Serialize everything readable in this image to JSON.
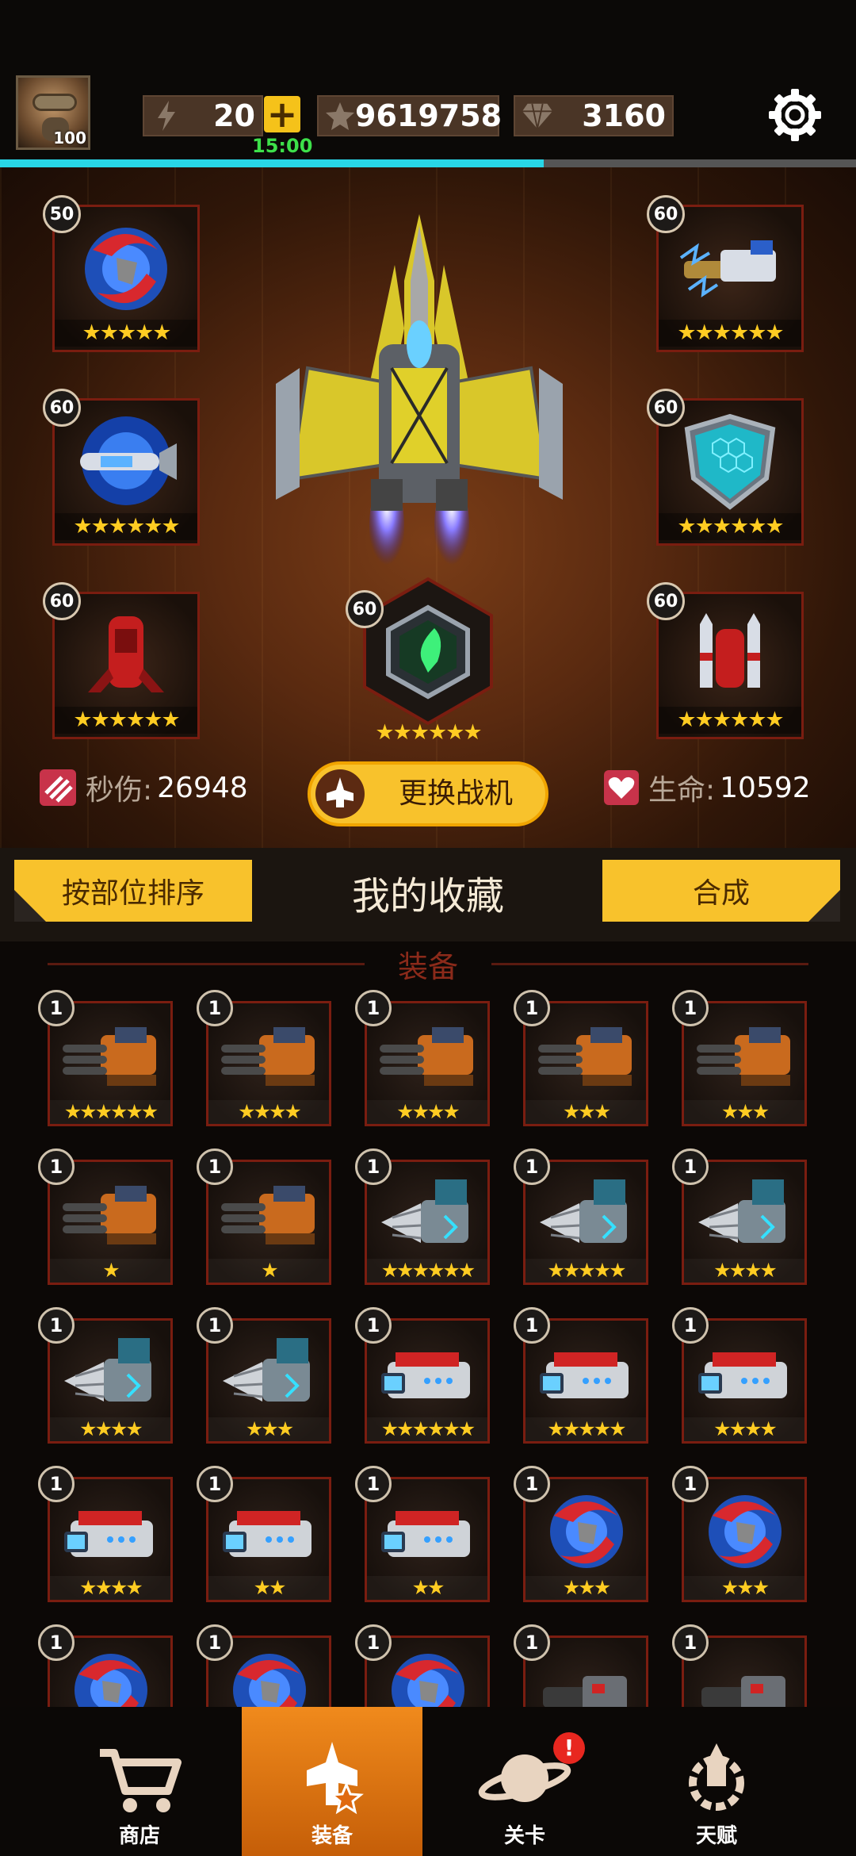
{
  "header": {
    "avatar_level": "100",
    "energy": "20",
    "energy_timer": "15:00",
    "stars": "9619758",
    "gems": "3160",
    "energy_progress": 0.635
  },
  "loadout": {
    "slots": [
      {
        "level": "50",
        "stars": "★★★★★",
        "icon": "red-blade-orb-icon"
      },
      {
        "level": "60",
        "stars": "★★★★★★",
        "icon": "electro-cannon-icon"
      },
      {
        "level": "60",
        "stars": "★★★★★★",
        "icon": "plasma-missile-icon"
      },
      {
        "level": "60",
        "stars": "★★★★★★",
        "icon": "hex-shield-icon"
      },
      {
        "level": "60",
        "stars": "★★★★★★",
        "icon": "red-drone-icon"
      },
      {
        "level": "60",
        "stars": "★★★★★★",
        "icon": "rocket-drone-icon"
      },
      {
        "level": "60",
        "stars": "★★★★★★",
        "icon": "green-core-icon"
      }
    ],
    "dps_label": "秒伤:",
    "dps_value": "26948",
    "hp_label": "生命:",
    "hp_value": "10592",
    "change_button": "更换战机"
  },
  "collection": {
    "sort_button": "按部位排序",
    "title": "我的收藏",
    "merge_button": "合成",
    "section_title": "装备"
  },
  "equipment": [
    {
      "level": "1",
      "stars": "★★★★★★",
      "type": "gatling"
    },
    {
      "level": "1",
      "stars": "★★★★",
      "type": "gatling"
    },
    {
      "level": "1",
      "stars": "★★★★",
      "type": "gatling"
    },
    {
      "level": "1",
      "stars": "★★★",
      "type": "gatling"
    },
    {
      "level": "1",
      "stars": "★★★",
      "type": "gatling"
    },
    {
      "level": "1",
      "stars": "★",
      "type": "gatling"
    },
    {
      "level": "1",
      "stars": "★",
      "type": "gatling"
    },
    {
      "level": "1",
      "stars": "★★★★★★",
      "type": "drill"
    },
    {
      "level": "1",
      "stars": "★★★★★",
      "type": "drill"
    },
    {
      "level": "1",
      "stars": "★★★★",
      "type": "drill"
    },
    {
      "level": "1",
      "stars": "★★★★",
      "type": "drill"
    },
    {
      "level": "1",
      "stars": "★★★",
      "type": "drill"
    },
    {
      "level": "1",
      "stars": "★★★★★★",
      "type": "laser"
    },
    {
      "level": "1",
      "stars": "★★★★★",
      "type": "laser"
    },
    {
      "level": "1",
      "stars": "★★★★",
      "type": "laser"
    },
    {
      "level": "1",
      "stars": "★★★★",
      "type": "laser"
    },
    {
      "level": "1",
      "stars": "★★",
      "type": "laser"
    },
    {
      "level": "1",
      "stars": "★★",
      "type": "laser"
    },
    {
      "level": "1",
      "stars": "★★★",
      "type": "orb"
    },
    {
      "level": "1",
      "stars": "★★★",
      "type": "orb"
    },
    {
      "level": "1",
      "stars": "",
      "type": "orb"
    },
    {
      "level": "1",
      "stars": "",
      "type": "orb"
    },
    {
      "level": "1",
      "stars": "",
      "type": "orb"
    },
    {
      "level": "1",
      "stars": "",
      "type": "cannon"
    },
    {
      "level": "1",
      "stars": "",
      "type": "cannon"
    }
  ],
  "nav": {
    "shop": "商店",
    "equipment": "装备",
    "levels": "关卡",
    "talent": "天赋",
    "levels_alert": "!"
  }
}
